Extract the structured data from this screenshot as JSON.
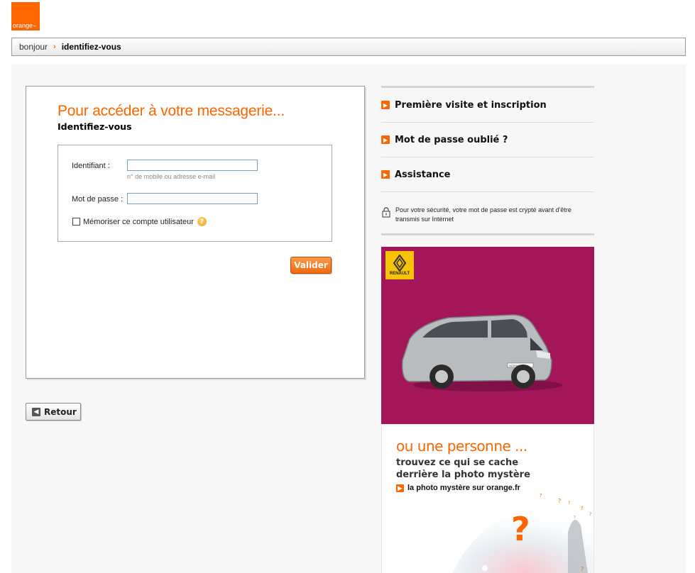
{
  "logo": {
    "text": "orange",
    "mark": "™"
  },
  "breadcrumb": {
    "items": [
      "bonjour",
      "identifiez-vous"
    ],
    "separator": "›"
  },
  "login": {
    "title": "Pour accéder à votre messagerie...",
    "subtitle": "Identifiez-vous",
    "identifiant_label": "Identifiant :",
    "identifiant_value": "",
    "identifiant_hint": "n° de mobile ou adresse e-mail",
    "password_label": "Mot de passe :",
    "password_value": "",
    "remember_label": "Mémoriser ce compte utilisateur",
    "remember_checked": false,
    "help_glyph": "?",
    "submit_label": "Valider"
  },
  "back_button": {
    "label": "Retour",
    "icon": "back-arrow-icon"
  },
  "side_menu": {
    "items": [
      {
        "label": "Première visite et inscription"
      },
      {
        "label": "Mot de passe oublié ?"
      },
      {
        "label": "Assistance"
      }
    ],
    "security_note": "Pour votre sécurité, votre mot de passe est crypté avant d'être transmis sur Internet"
  },
  "ads": {
    "renault": {
      "brand": "RENAULT",
      "model_plate": "SCENIC",
      "background": "#a3165a"
    },
    "photo_mystere": {
      "headline": "ou une personne ...",
      "tagline": "trouvez ce qui se cache derrière la photo mystère",
      "link": "la photo mystère sur orange.fr",
      "question_mark": "?"
    }
  },
  "colors": {
    "accent": "#ff6600",
    "page_bg": "#f7f7f7"
  }
}
